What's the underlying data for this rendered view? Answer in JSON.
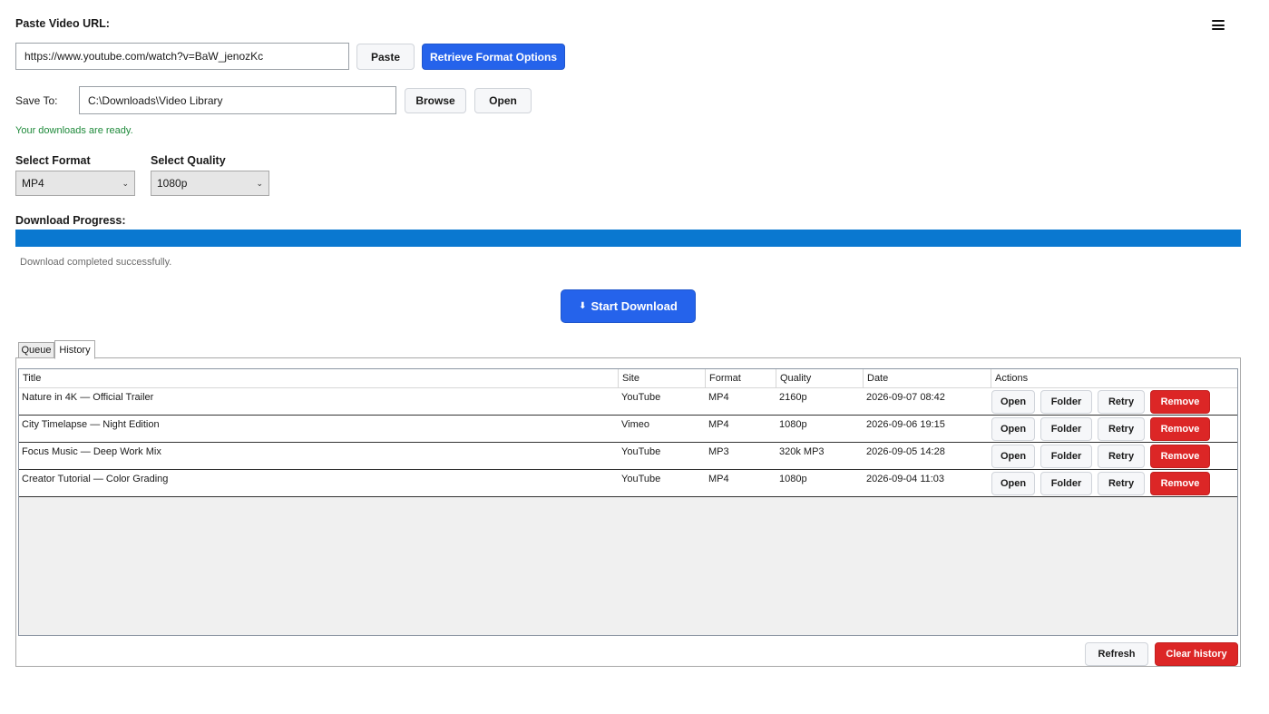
{
  "url_section": {
    "label": "Paste Video URL:",
    "url_value": "https://www.youtube.com/watch?v=BaW_jenozKc",
    "paste_label": "Paste",
    "retrieve_label": "Retrieve Format Options"
  },
  "save_section": {
    "label": "Save To:",
    "path_value": "C:\\Downloads\\Video Library",
    "browse_label": "Browse",
    "open_label": "Open",
    "status": "Your downloads are ready."
  },
  "format": {
    "label": "Select Format",
    "value": "MP4"
  },
  "quality": {
    "label": "Select Quality",
    "value": "1080p"
  },
  "progress": {
    "label": "Download Progress:",
    "percent": 100,
    "status": "Download completed successfully."
  },
  "start_button": {
    "icon": "⬇",
    "label": "Start Download"
  },
  "tabs": [
    {
      "label": "Queue",
      "active": false
    },
    {
      "label": "History",
      "active": true
    }
  ],
  "history": {
    "columns": [
      "Title",
      "Site",
      "Format",
      "Quality",
      "Date",
      "Actions"
    ],
    "rows": [
      {
        "title": "Nature in 4K — Official Trailer",
        "site": "YouTube",
        "format": "MP4",
        "quality": "2160p",
        "date": "2026-09-07 08:42"
      },
      {
        "title": "City Timelapse — Night Edition",
        "site": "Vimeo",
        "format": "MP4",
        "quality": "1080p",
        "date": "2026-09-06 19:15"
      },
      {
        "title": "Focus Music — Deep Work Mix",
        "site": "YouTube",
        "format": "MP3",
        "quality": "320k MP3",
        "date": "2026-09-05 14:28"
      },
      {
        "title": "Creator Tutorial — Color Grading",
        "site": "YouTube",
        "format": "MP4",
        "quality": "1080p",
        "date": "2026-09-04 11:03"
      }
    ],
    "row_actions": {
      "open": "Open",
      "folder": "Folder",
      "retry": "Retry",
      "remove": "Remove"
    },
    "refresh_label": "Refresh",
    "clear_label": "Clear history"
  },
  "colors": {
    "primary": "#2563eb",
    "danger": "#dc2626",
    "progress": "#0a78d0",
    "success_text": "#1f8a3b"
  },
  "icons": {
    "menu": "hamburger-menu-icon",
    "download": "download-arrow-icon",
    "dropdown": "chevron-down-icon"
  }
}
